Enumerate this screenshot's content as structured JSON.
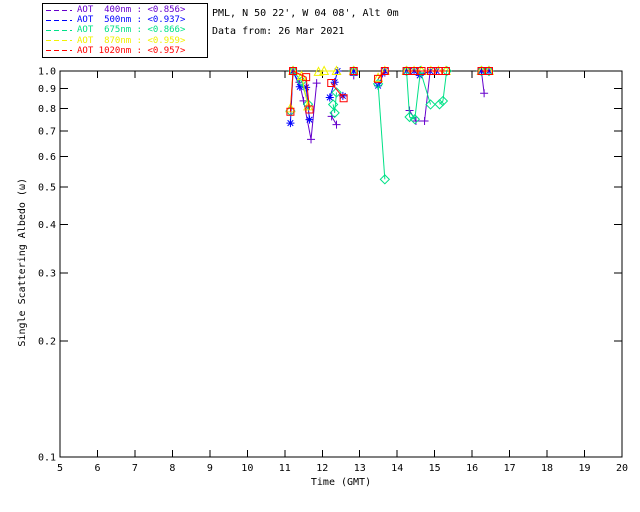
{
  "header": {
    "site_line": "PML, N 50 22', W 04 08', Alt 0m",
    "date_line": "Data from: 26 Mar 2021"
  },
  "legend": {
    "entries": [
      {
        "label": "AOT  400nm : <0.856>",
        "color": "#6600CC"
      },
      {
        "label": "AOT  500nm : <0.937>",
        "color": "#0000FF"
      },
      {
        "label": "AOT  675nm : <0.866>",
        "color": "#00E187"
      },
      {
        "label": "AOT  870nm : <0.959>",
        "color": "#F2F200"
      },
      {
        "label": "AOT 1020nm : <0.957>",
        "color": "#FF0000"
      }
    ]
  },
  "colors": {
    "background": "#FFFFFF",
    "axis": "#000000",
    "text": "#000000"
  },
  "chart_data": {
    "type": "scatter",
    "title": "",
    "xlabel": "Time (GMT)",
    "ylabel": "Single Scattering Albedo (ω)",
    "xlim": [
      5,
      20
    ],
    "ylim": [
      0.1,
      1.0
    ],
    "y_scale": "log",
    "x_ticks": [
      5,
      6,
      7,
      8,
      9,
      10,
      11,
      12,
      13,
      14,
      15,
      16,
      17,
      18,
      19,
      20
    ],
    "y_tick_labels": [
      "1.0",
      "0.9",
      "0.8",
      "0.7",
      "0.6",
      "0.5",
      "0.4",
      "0.3",
      "0.2",
      "0.1"
    ],
    "grid": false,
    "legend_position": "top-left",
    "series": [
      {
        "name": "AOT 400nm",
        "mean_value": "<0.856>",
        "color": "#6600CC",
        "marker": "plus",
        "segments": [
          [
            [
              11.22,
              0.99
            ],
            [
              11.39,
              0.935
            ],
            [
              11.5,
              0.837
            ],
            [
              11.7,
              0.665
            ],
            [
              11.85,
              0.93
            ]
          ],
          [
            [
              12.25,
              0.763
            ],
            [
              12.38,
              0.726
            ]
          ],
          [
            [
              12.84,
              0.974
            ]
          ],
          [
            [
              13.67,
              0.99
            ]
          ],
          [
            [
              14.33,
              0.79
            ],
            [
              14.5,
              0.742
            ],
            [
              14.73,
              0.742
            ],
            [
              14.88,
              1.0
            ],
            [
              15.05,
              1.0
            ]
          ],
          [
            [
              16.25,
              0.995
            ],
            [
              16.32,
              0.876
            ]
          ]
        ]
      },
      {
        "name": "AOT 500nm",
        "mean_value": "<0.937>",
        "color": "#0000FF",
        "marker": "asterisk",
        "segments": [
          [
            [
              11.15,
              0.733
            ],
            [
              11.22,
              1.0
            ],
            [
              11.4,
              0.91
            ],
            [
              11.57,
              0.907
            ],
            [
              11.66,
              0.748
            ]
          ],
          [
            [
              12.2,
              0.854
            ],
            [
              12.33,
              0.935
            ],
            [
              12.41,
              1.0
            ]
          ],
          [
            [
              12.55,
              0.862
            ]
          ],
          [
            [
              12.84,
              1.0
            ]
          ],
          [
            [
              13.49,
              0.916
            ],
            [
              13.67,
              1.0
            ]
          ],
          [
            [
              14.25,
              1.0
            ],
            [
              14.45,
              1.0
            ],
            [
              14.6,
              0.974
            ],
            [
              14.88,
              1.0
            ],
            [
              15.05,
              1.0
            ]
          ],
          [
            [
              16.25,
              1.0
            ],
            [
              16.45,
              1.0
            ]
          ]
        ]
      },
      {
        "name": "AOT 675nm",
        "mean_value": "<0.866>",
        "color": "#00E187",
        "marker": "diamond",
        "segments": [
          [
            [
              11.15,
              0.787
            ],
            [
              11.22,
              1.0
            ],
            [
              11.45,
              0.94
            ],
            [
              11.62,
              0.82
            ]
          ],
          [
            [
              12.29,
              0.819
            ],
            [
              12.33,
              0.779
            ],
            [
              12.38,
              0.88
            ]
          ],
          [
            [
              12.84,
              1.0
            ]
          ],
          [
            [
              13.49,
              0.926
            ],
            [
              13.67,
              0.524
            ]
          ],
          [
            [
              14.25,
              1.0
            ],
            [
              14.33,
              0.76
            ],
            [
              14.47,
              0.75
            ],
            [
              14.62,
              1.0
            ],
            [
              14.89,
              0.819
            ]
          ],
          [
            [
              15.13,
              0.82
            ],
            [
              15.22,
              0.836
            ],
            [
              15.32,
              1.0
            ]
          ],
          [
            [
              16.25,
              1.0
            ],
            [
              16.45,
              1.0
            ]
          ]
        ]
      },
      {
        "name": "AOT 870nm",
        "mean_value": "<0.959>",
        "color": "#F2F200",
        "marker": "triangle",
        "segments": [
          [
            [
              11.15,
              0.8
            ],
            [
              11.22,
              1.0
            ],
            [
              11.45,
              0.97
            ],
            [
              11.62,
              0.81
            ]
          ],
          [
            [
              11.9,
              0.995
            ],
            [
              12.05,
              1.0
            ],
            [
              12.38,
              1.0
            ]
          ],
          [
            [
              12.84,
              1.0
            ]
          ],
          [
            [
              13.49,
              0.96
            ],
            [
              13.67,
              1.0
            ]
          ],
          [
            [
              14.25,
              1.0
            ],
            [
              14.45,
              1.0
            ],
            [
              14.65,
              1.0
            ],
            [
              14.9,
              1.0
            ],
            [
              15.1,
              1.0
            ],
            [
              15.3,
              1.0
            ]
          ],
          [
            [
              16.25,
              1.0
            ],
            [
              16.45,
              1.0
            ]
          ]
        ]
      },
      {
        "name": "AOT 1020nm",
        "mean_value": "<0.957>",
        "color": "#FF0000",
        "marker": "square",
        "segments": [
          [
            [
              11.15,
              0.784
            ],
            [
              11.22,
              1.0
            ],
            [
              11.57,
              0.964
            ],
            [
              11.66,
              0.795
            ]
          ],
          [
            [
              12.24,
              0.931
            ],
            [
              12.57,
              0.85
            ]
          ],
          [
            [
              12.84,
              1.0
            ]
          ],
          [
            [
              13.49,
              0.954
            ],
            [
              13.67,
              1.0
            ]
          ],
          [
            [
              14.25,
              1.0
            ],
            [
              14.45,
              1.0
            ],
            [
              14.65,
              1.0
            ],
            [
              14.9,
              1.0
            ],
            [
              15.1,
              1.0
            ],
            [
              15.3,
              1.0
            ]
          ],
          [
            [
              16.25,
              1.0
            ],
            [
              16.45,
              1.0
            ]
          ]
        ]
      }
    ]
  }
}
